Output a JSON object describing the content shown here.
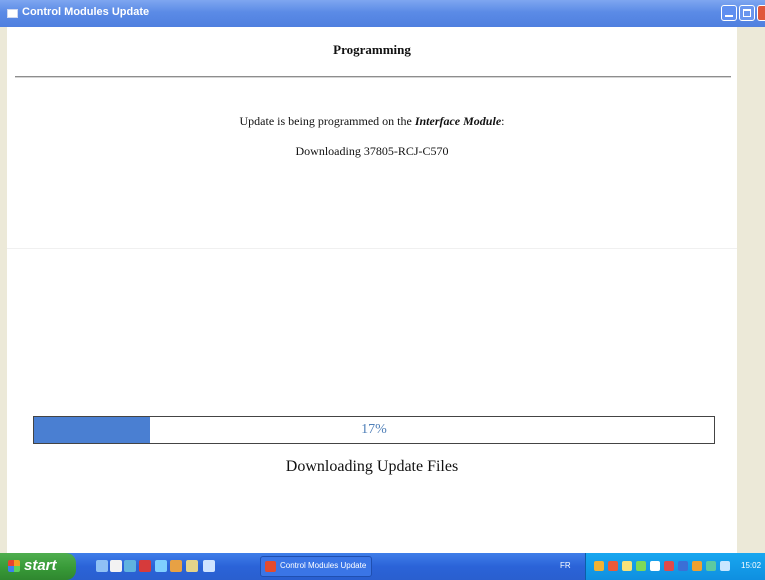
{
  "window": {
    "title": "Control Modules Update"
  },
  "page": {
    "heading": "Programming",
    "message_prefix": "Update is being programmed on the ",
    "message_module": "Interface Module",
    "message_suffix": ":",
    "download_line": "Downloading 37805-RCJ-C570"
  },
  "progress": {
    "percent": 17,
    "label": "17%",
    "status": "Downloading Update Files"
  },
  "taskbar": {
    "start_label": "start",
    "task_title": "Control Modules Update",
    "language": "FR",
    "clock": "15:02"
  },
  "colors": {
    "progress_fill": "#4a7fd2",
    "title_bar": "#5b8be6",
    "taskbar": "#2b63d8"
  }
}
